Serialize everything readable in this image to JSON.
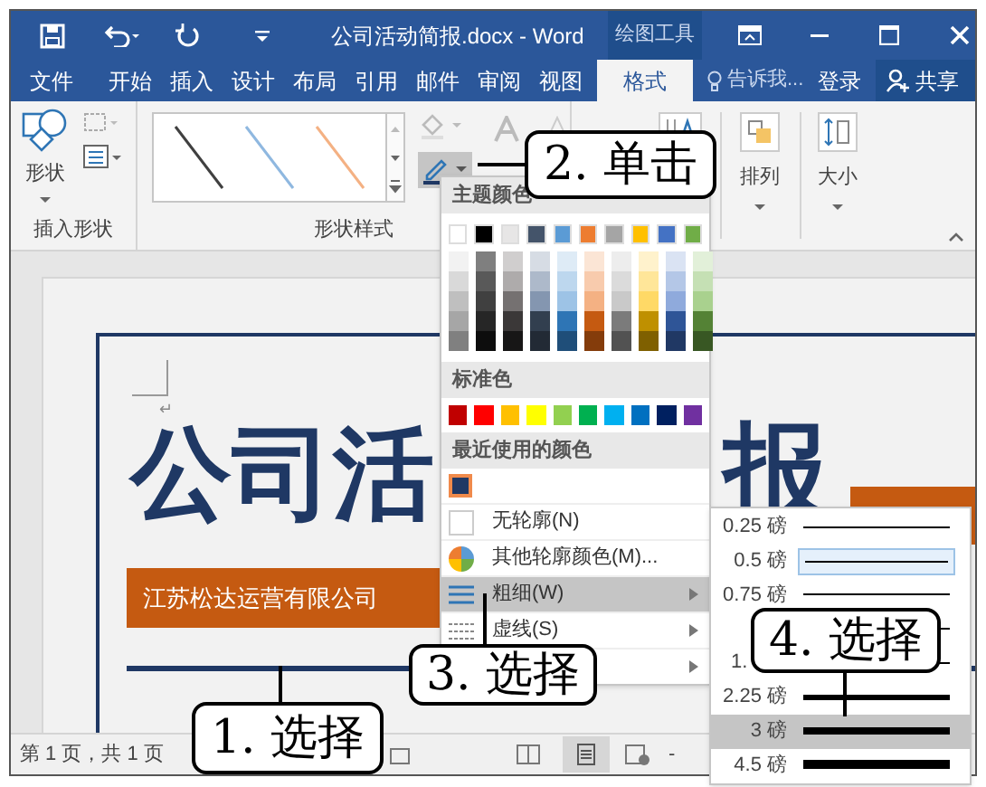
{
  "title_bar": {
    "title": "公司活动简报.docx - Word",
    "context_label": "绘图工具"
  },
  "tabs": [
    {
      "label": "文件",
      "selected": false
    },
    {
      "label": "开始",
      "selected": false
    },
    {
      "label": "插入",
      "selected": false
    },
    {
      "label": "设计",
      "selected": false
    },
    {
      "label": "布局",
      "selected": false
    },
    {
      "label": "引用",
      "selected": false
    },
    {
      "label": "邮件",
      "selected": false
    },
    {
      "label": "审阅",
      "selected": false
    },
    {
      "label": "视图",
      "selected": false
    },
    {
      "label": "格式",
      "selected": true
    }
  ],
  "tell_me": "告诉我...",
  "sign_in": "登录",
  "share": "共享",
  "ribbon": {
    "shape_button": "形状",
    "groups": [
      "插入形状",
      "形状样式"
    ],
    "arrange": "排列",
    "size": "大小"
  },
  "outline_menu": {
    "theme_header": "主题颜色",
    "theme_colors": [
      {
        "color": "#ffffff",
        "shades": [
          {
            "color": "#f2f2f2"
          },
          {
            "color": "#d9d9d9"
          },
          {
            "color": "#bfbfbf"
          },
          {
            "color": "#a6a6a6"
          },
          {
            "color": "#808080"
          }
        ]
      },
      {
        "color": "#000000",
        "shades": [
          {
            "color": "#7f7f7f"
          },
          {
            "color": "#595959"
          },
          {
            "color": "#404040"
          },
          {
            "color": "#262626"
          },
          {
            "color": "#0d0d0d"
          }
        ]
      },
      {
        "color": "#e7e6e6",
        "shades": [
          {
            "color": "#d0cece"
          },
          {
            "color": "#aeabab"
          },
          {
            "color": "#757171"
          },
          {
            "color": "#3b3838"
          },
          {
            "color": "#171616"
          }
        ]
      },
      {
        "color": "#44546a",
        "shades": [
          {
            "color": "#d6dce4"
          },
          {
            "color": "#adb9ca"
          },
          {
            "color": "#8496b0"
          },
          {
            "color": "#323f4f"
          },
          {
            "color": "#222a35"
          }
        ]
      },
      {
        "color": "#5b9bd5",
        "shades": [
          {
            "color": "#deebf6"
          },
          {
            "color": "#bdd7ee"
          },
          {
            "color": "#9dc3e6"
          },
          {
            "color": "#2e75b5"
          },
          {
            "color": "#1f4e79"
          }
        ]
      },
      {
        "color": "#ed7d31",
        "shades": [
          {
            "color": "#fbe5d5"
          },
          {
            "color": "#f8cbad"
          },
          {
            "color": "#f4b183"
          },
          {
            "color": "#c55a11"
          },
          {
            "color": "#843c0b"
          }
        ]
      },
      {
        "color": "#a5a5a5",
        "shades": [
          {
            "color": "#ededed"
          },
          {
            "color": "#dbdbdb"
          },
          {
            "color": "#c9c9c9"
          },
          {
            "color": "#7b7b7b"
          },
          {
            "color": "#525252"
          }
        ]
      },
      {
        "color": "#ffc000",
        "shades": [
          {
            "color": "#fff2cc"
          },
          {
            "color": "#ffe699"
          },
          {
            "color": "#ffd966"
          },
          {
            "color": "#bf9000"
          },
          {
            "color": "#7f6000"
          }
        ]
      },
      {
        "color": "#4472c4",
        "shades": [
          {
            "color": "#dae3f3"
          },
          {
            "color": "#b4c7e7"
          },
          {
            "color": "#8faadc"
          },
          {
            "color": "#2f5597"
          },
          {
            "color": "#203864"
          }
        ]
      },
      {
        "color": "#70ad47",
        "shades": [
          {
            "color": "#e2f0d9"
          },
          {
            "color": "#c5e0b4"
          },
          {
            "color": "#a9d18e"
          },
          {
            "color": "#548235"
          },
          {
            "color": "#385723"
          }
        ]
      }
    ],
    "standard_header": "标准色",
    "standard_colors": [
      {
        "color": "#c00000"
      },
      {
        "color": "#ff0000"
      },
      {
        "color": "#ffc000"
      },
      {
        "color": "#ffff00"
      },
      {
        "color": "#92d050"
      },
      {
        "color": "#00b050"
      },
      {
        "color": "#00b0f0"
      },
      {
        "color": "#0070c0"
      },
      {
        "color": "#002060"
      },
      {
        "color": "#7030a0"
      }
    ],
    "recent_header": "最近使用的颜色",
    "recent_colors": [
      {
        "color": "#203864",
        "selected": true
      }
    ],
    "items": [
      {
        "kind": "none",
        "label": "无轮廓(N)",
        "highlighted": false,
        "submenu": false
      },
      {
        "kind": "more",
        "label": "其他轮廓颜色(M)...",
        "highlighted": false,
        "submenu": false
      },
      {
        "kind": "weight",
        "label": "粗细(W)",
        "highlighted": true,
        "submenu": true
      },
      {
        "kind": "dash",
        "label": "虚线(S)",
        "highlighted": false,
        "submenu": true
      },
      {
        "kind": "arrow",
        "highlighted": false,
        "submenu": true
      }
    ]
  },
  "weight_menu": [
    {
      "label": "0.25 磅",
      "selected": false
    },
    {
      "label": "0.5 磅",
      "selected": true
    },
    {
      "label": "0.75 磅",
      "selected": false
    },
    {
      "selected": false
    },
    {
      "label": "1.",
      "kind": "cut",
      "selected": false
    },
    {
      "label": "2.25 磅",
      "selected": false
    },
    {
      "label": "3 磅",
      "selected": true
    },
    {
      "label": "4.5 磅",
      "selected": false
    }
  ],
  "document": {
    "return_mark": "↵",
    "title_left": "公司活",
    "title_right": "报",
    "subtitle": "江苏松达运营有限公司"
  },
  "status_bar": {
    "page": "第 1 页，共 1 页",
    "zoom_minus": "-"
  },
  "callouts": [
    "2. 单击",
    "3. 选择",
    "4. 选择",
    "1. 选择"
  ]
}
